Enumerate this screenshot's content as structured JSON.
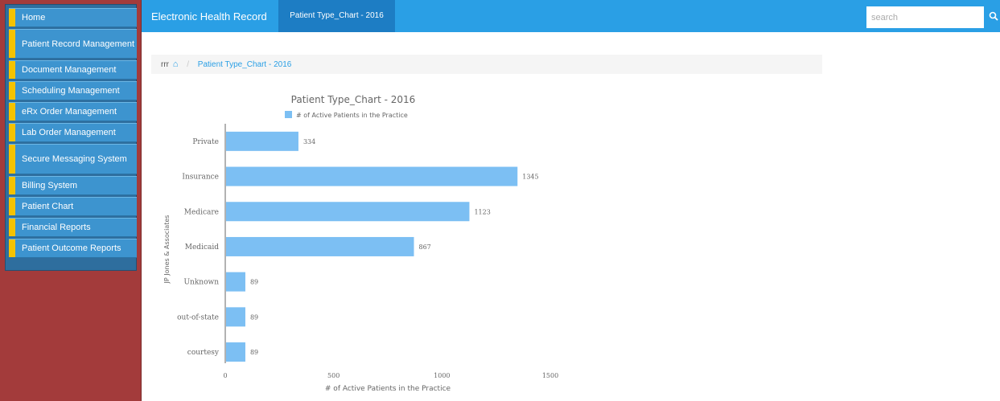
{
  "sidebar": {
    "items": [
      {
        "label": "Home"
      },
      {
        "label": "Patient Record Management"
      },
      {
        "label": "Document Management"
      },
      {
        "label": "Scheduling Management"
      },
      {
        "label": "eRx Order Management"
      },
      {
        "label": "Lab Order Management"
      },
      {
        "label": "Secure Messaging System"
      },
      {
        "label": "Billing System"
      },
      {
        "label": "Patient Chart"
      },
      {
        "label": "Financial Reports"
      },
      {
        "label": "Patient Outcome Reports"
      }
    ]
  },
  "header": {
    "app_title": "Electronic Health Record",
    "active_tab": "Patient Type_Chart - 2016",
    "search_placeholder": "search",
    "search_icon": "magnifier-icon"
  },
  "breadcrumb": {
    "home_label": "rrr",
    "home_icon": "house-icon",
    "current": "Patient Type_Chart - 2016"
  },
  "colors": {
    "header": "#2a9fe5",
    "active_tab": "#1d7dc4",
    "sidebar_bg": "#a33b3b",
    "nav_item": "#3d94cf",
    "nav_marker": "#f5c300",
    "bar": "#7cbff3"
  },
  "chart_data": {
    "type": "bar",
    "orientation": "horizontal",
    "title": "Patient Type_Chart - 2016",
    "legend": "# of Active Patients in the Practice",
    "legend_position": "top",
    "xlabel": "# of Active Patients in the Practice",
    "ylabel": "JP Jones & Associates",
    "categories": [
      "Private",
      "Insurance",
      "Medicare",
      "Medicaid",
      "Unknown",
      "out-of-state",
      "courtesy"
    ],
    "values": [
      334,
      1345,
      1123,
      867,
      89,
      89,
      89
    ],
    "data_labels": [
      "334",
      "1345",
      "1123",
      "867",
      "89",
      "89",
      "89"
    ],
    "xlim": [
      0,
      1500
    ],
    "xticks": [
      "0",
      "500",
      "1000",
      "1500"
    ],
    "grid": false
  }
}
